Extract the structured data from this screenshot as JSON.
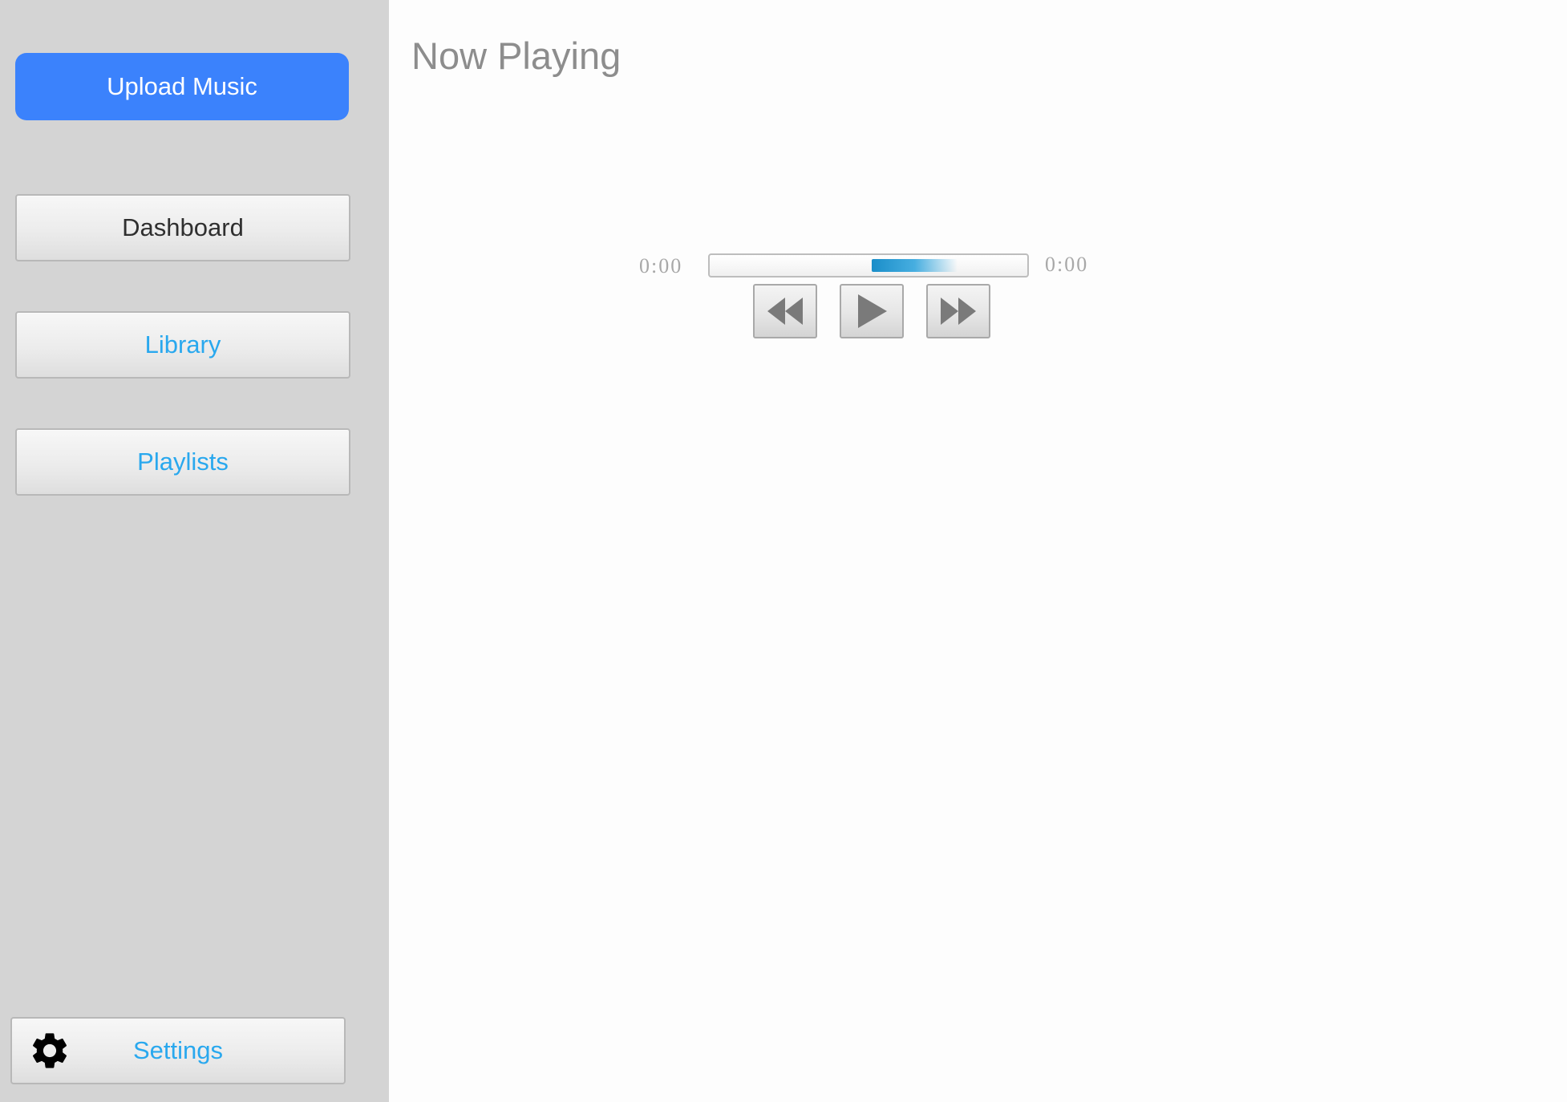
{
  "sidebar": {
    "upload_label": "Upload Music",
    "items": [
      {
        "label": "Dashboard"
      },
      {
        "label": "Library"
      },
      {
        "label": "Playlists"
      }
    ],
    "settings_label": "Settings"
  },
  "main": {
    "title": "Now Playing",
    "player": {
      "elapsed": "0:00",
      "total": "0:00",
      "progress_fill_start": 0.51,
      "progress_fill_end": 0.78,
      "controls": {
        "rewind_icon": "rewind-icon",
        "play_icon": "play-icon",
        "forward_icon": "fast-forward-icon"
      }
    }
  },
  "colors": {
    "accent": "#3b82fc",
    "link": "#29a8ee",
    "sidebar_bg": "#d4d4d4",
    "progress": "#1a8ec9"
  }
}
